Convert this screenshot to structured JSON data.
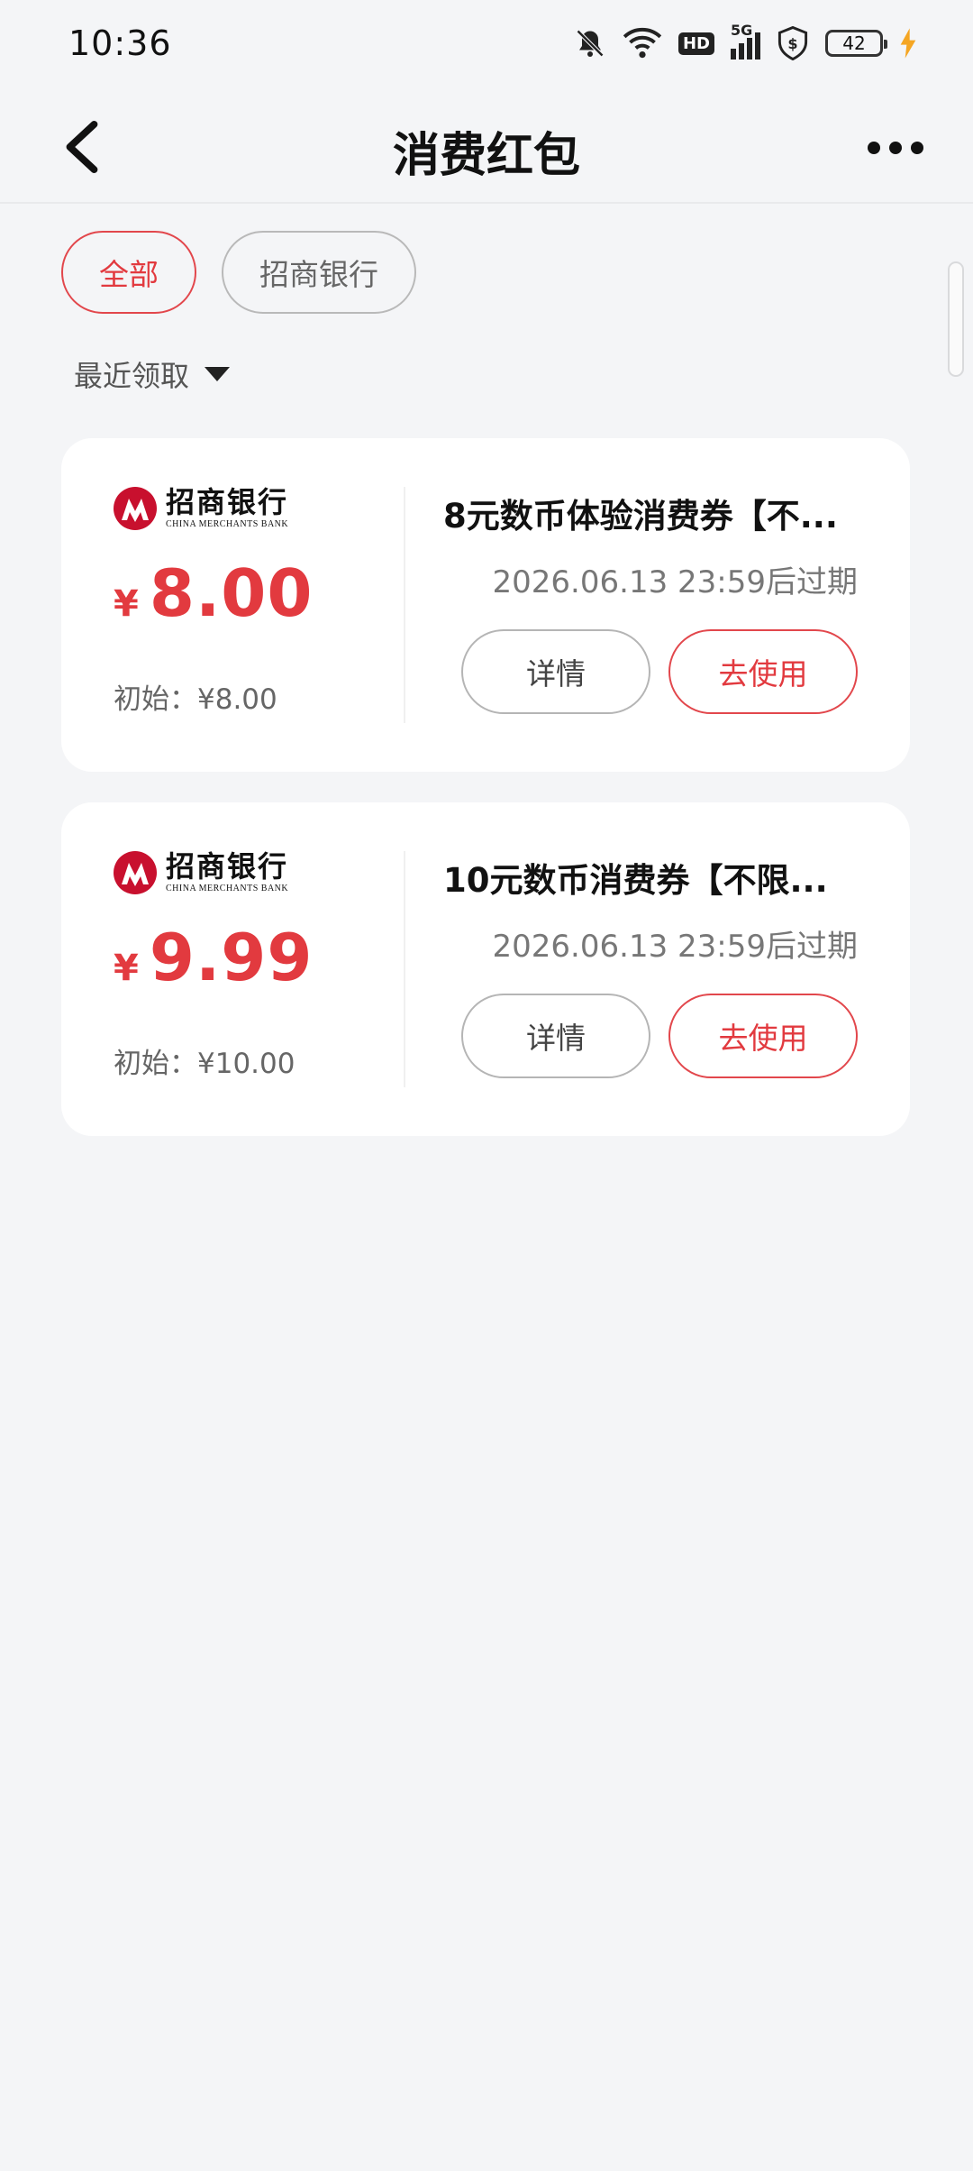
{
  "status_bar": {
    "time": "10:36",
    "battery": "42",
    "icons": [
      "mute-icon",
      "wifi-icon",
      "hd-icon",
      "5g-signal-icon",
      "shield-dollar-icon",
      "battery-icon",
      "charging-icon"
    ],
    "network_label": "5G",
    "hd_label": "HD"
  },
  "navbar": {
    "title": "消费红包",
    "back_icon": "chevron-left-icon",
    "more_icon": "more-horizontal-icon"
  },
  "filters": {
    "all_label": "全部",
    "bank_label": "招商银行"
  },
  "sort": {
    "label": "最近领取",
    "icon": "caret-down-icon"
  },
  "bank_logo": {
    "name_cn": "招商银行",
    "name_en": "CHINA MERCHANTS BANK"
  },
  "coupons": [
    {
      "currency": "¥",
      "amount": "8.00",
      "initial": "初始：¥8.00",
      "title": "8元数币体验消费券【不...",
      "expire": "2026.06.13 23:59后过期",
      "detail_label": "详情",
      "use_label": "去使用"
    },
    {
      "currency": "¥",
      "amount": "9.99",
      "initial": "初始：¥10.00",
      "title": "10元数币消费券【不限...",
      "expire": "2026.06.13 23:59后过期",
      "detail_label": "详情",
      "use_label": "去使用"
    }
  ],
  "colors": {
    "accent": "#e23a3f",
    "background": "#f4f5f7",
    "card": "#ffffff",
    "logo": "#c8102e"
  }
}
